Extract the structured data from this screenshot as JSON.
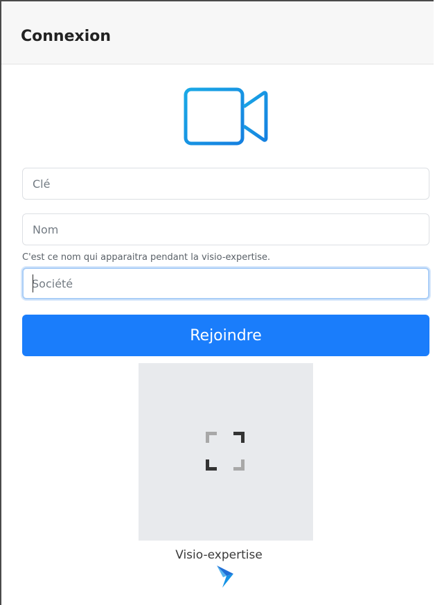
{
  "header": {
    "title": "Connexion"
  },
  "icons": {
    "camera": "video-camera-icon",
    "fullscreen": "fullscreen-icon",
    "brand": "bird-logo-icon"
  },
  "form": {
    "key_placeholder": "Clé",
    "name_placeholder": "Nom",
    "name_hint": "C'est ce nom qui apparaitra pendant la visio-expertise.",
    "company_placeholder": "Société",
    "submit_label": "Rejoindre"
  },
  "footer": {
    "brand_name": "Visio-expertise"
  },
  "colors": {
    "accent": "#1a7dfb",
    "camera": "#1aa3e8"
  }
}
